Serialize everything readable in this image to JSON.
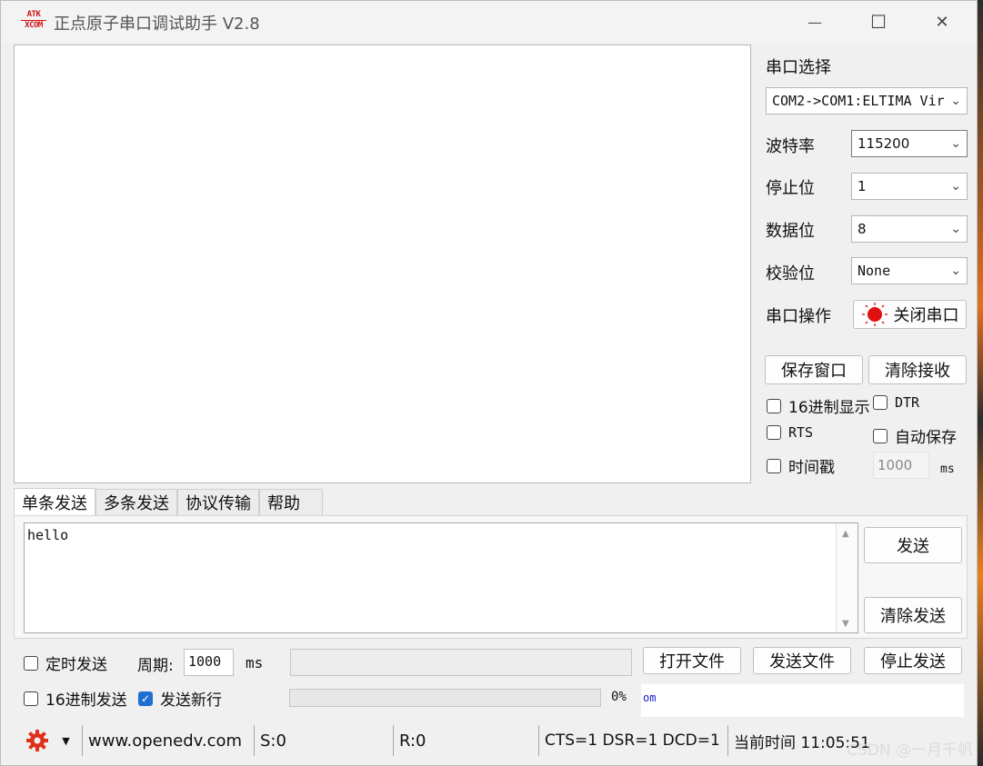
{
  "window": {
    "title": "正点原子串口调试助手 V2.8",
    "logo_text_top": "ATK",
    "logo_text_bottom": "XCOM",
    "minimize_glyph": "—",
    "maximize_glyph": "☐",
    "close_glyph": "✕"
  },
  "serial": {
    "port_label": "串口选择",
    "port_value": "COM2->COM1:ELTIMA Vir",
    "baud_label": "波特率",
    "baud_value": "115200",
    "stop_label": "停止位",
    "stop_value": "1",
    "data_label": "数据位",
    "data_value": "8",
    "parity_label": "校验位",
    "parity_value": "None",
    "op_label": "串口操作",
    "op_button": "关闭串口",
    "op_status_color": "#e01010"
  },
  "receive": {
    "save_button": "保存窗口",
    "clear_button": "清除接收",
    "hex_display": "16进制显示",
    "dtr": "DTR",
    "rts": "RTS",
    "auto_save": "自动保存",
    "timestamp": "时间戳",
    "timestamp_ms": "1000",
    "ms_unit": "ms"
  },
  "tabs": [
    "单条发送",
    "多条发送",
    "协议传输",
    "帮助"
  ],
  "send": {
    "text": "hello",
    "send_button": "发送",
    "clear_send_button": "清除发送",
    "timed_send": "定时发送",
    "period_label": "周期:",
    "period_value": "1000",
    "period_unit": "ms",
    "open_file": "打开文件",
    "send_file": "发送文件",
    "stop_send": "停止发送",
    "hex_send": "16进制发送",
    "send_newline": "发送新行",
    "progress_percent": "0%",
    "progress_value": 0,
    "url_fragment": "om"
  },
  "status": {
    "gear_icon": "gear-icon",
    "website": "www.openedv.com",
    "sent": "S:0",
    "received": "R:0",
    "lines": "CTS=1 DSR=1 DCD=1",
    "time": "当前时间 11:05:51"
  },
  "watermark": "CSDN @一月千帆"
}
